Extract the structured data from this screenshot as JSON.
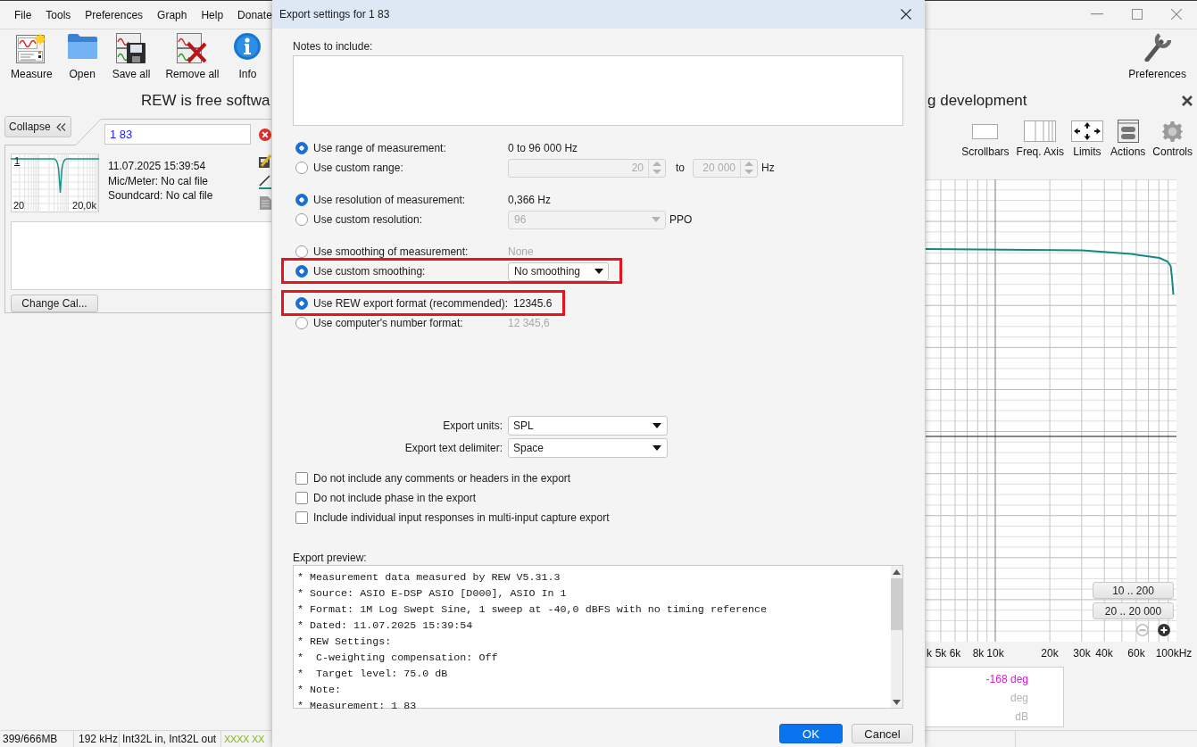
{
  "app": {
    "menu": [
      "File",
      "Tools",
      "Preferences",
      "Graph",
      "Help",
      "Donate"
    ],
    "toolbar": [
      {
        "label": "Measure",
        "kind": "measure"
      },
      {
        "label": "Open",
        "kind": "open"
      },
      {
        "label": "Save all",
        "kind": "save_all"
      },
      {
        "label": "Remove all",
        "kind": "remove_all"
      },
      {
        "label": "Info",
        "kind": "info"
      }
    ],
    "toolbar_right": [
      {
        "label": "Preferences",
        "kind": "preferences"
      }
    ],
    "banner": {
      "left": "REW is free softwa",
      "right": "g development"
    },
    "panel": {
      "collapse": "Collapse",
      "filter": "1 83",
      "measurement": {
        "number": "1",
        "axis_start": "20",
        "axis_end": "20,0k",
        "date": "11.07.2025 15:39:54",
        "mic": "Mic/Meter: No cal file",
        "soundcard": "Soundcard: No cal file"
      },
      "change_cal": "Change Cal..."
    },
    "graph_toolbar": [
      {
        "label": "Scrollbars",
        "kind": "scrollbars"
      },
      {
        "label": "Freq. Axis",
        "kind": "freq_axis"
      },
      {
        "label": "Limits",
        "kind": "limits"
      },
      {
        "label": "Actions",
        "kind": "actions"
      },
      {
        "label": "Controls",
        "kind": "controls"
      }
    ],
    "graph": {
      "x_labels": [
        "k",
        "5k",
        "6k",
        "8k",
        "10k",
        "20k",
        "30k",
        "40k",
        "60k",
        "100kHz"
      ],
      "range_buttons": [
        "10 .. 200",
        "20 .. 20 000"
      ],
      "zoom_controls": [
        {
          "kind": "zoom_out",
          "disabled": true
        },
        {
          "kind": "zoom_in",
          "disabled": false
        }
      ]
    },
    "readouts": [
      {
        "text": "-168 deg",
        "color": "#d21ed2"
      },
      {
        "text": "deg",
        "color": "#b4b4b4"
      },
      {
        "text": "dB",
        "color": "#b4b4b4"
      }
    ],
    "status_bar": [
      {
        "text": "399/666MB",
        "kind": "plain"
      },
      {
        "text": "192 kHz",
        "kind": "plain"
      },
      {
        "text": "Int32L in, Int32L out",
        "kind": "plain"
      },
      {
        "text": "XXXX XX",
        "kind": "meter"
      }
    ]
  },
  "dialog": {
    "title": "Export settings for 1 83",
    "notes_label": "Notes to include:",
    "option_groups": [
      {
        "options": [
          {
            "label": "Use range of measurement:",
            "selected": true,
            "highlighted": false,
            "kind": "value",
            "value": "0 to 96 000 Hz",
            "disabled": false
          },
          {
            "label": "Use custom range:",
            "selected": false,
            "highlighted": false,
            "kind": "range",
            "value": "20",
            "to_label": "to",
            "to_value": "20 000",
            "unit": "Hz",
            "disabled": true
          }
        ]
      },
      {
        "options": [
          {
            "label": "Use resolution of measurement:",
            "selected": true,
            "highlighted": false,
            "kind": "value",
            "value": "0,366 Hz",
            "disabled": false
          },
          {
            "label": "Use custom resolution:",
            "selected": false,
            "highlighted": false,
            "kind": "dropdown",
            "value": "96",
            "unit": "PPO",
            "disabled": true
          }
        ]
      },
      {
        "options": [
          {
            "label": "Use smoothing of measurement:",
            "selected": false,
            "highlighted": false,
            "kind": "value",
            "value": "None",
            "disabled": true
          },
          {
            "label": "Use custom smoothing:",
            "selected": true,
            "highlighted": true,
            "kind": "dropdown",
            "value": "No smoothing",
            "disabled": false
          }
        ]
      },
      {
        "options": [
          {
            "label": "Use REW export format (recommended):",
            "selected": true,
            "highlighted": true,
            "kind": "value",
            "value": "12345.6",
            "disabled": false
          },
          {
            "label": "Use computer's number format:",
            "selected": false,
            "highlighted": false,
            "kind": "value",
            "value": "12 345,6",
            "disabled": true
          }
        ]
      }
    ],
    "selects": [
      {
        "label": "Export units:",
        "value": "SPL"
      },
      {
        "label": "Export text delimiter:",
        "value": "Space"
      }
    ],
    "checkboxes": [
      {
        "label": "Do not include any comments or headers in the export",
        "checked": false
      },
      {
        "label": "Do not include phase in the export",
        "checked": false
      },
      {
        "label": "Include individual input responses in multi-input capture export",
        "checked": false
      }
    ],
    "preview_label": "Export preview:",
    "preview_lines": [
      "* Measurement data measured by REW V5.31.3",
      "* Source: ASIO E-DSP ASIO [D000], ASIO In 1",
      "* Format: 1M Log Swept Sine, 1 sweep at -40,0 dBFS with no timing reference",
      "* Dated: 11.07.2025 15:39:54",
      "* REW Settings:",
      "*  C-weighting compensation: Off",
      "*  Target level: 75.0 dB",
      "* Note:",
      "* Measurement: 1 83"
    ],
    "buttons": [
      {
        "label": "OK",
        "kind": "primary"
      },
      {
        "label": "Cancel",
        "kind": "secondary"
      }
    ]
  }
}
